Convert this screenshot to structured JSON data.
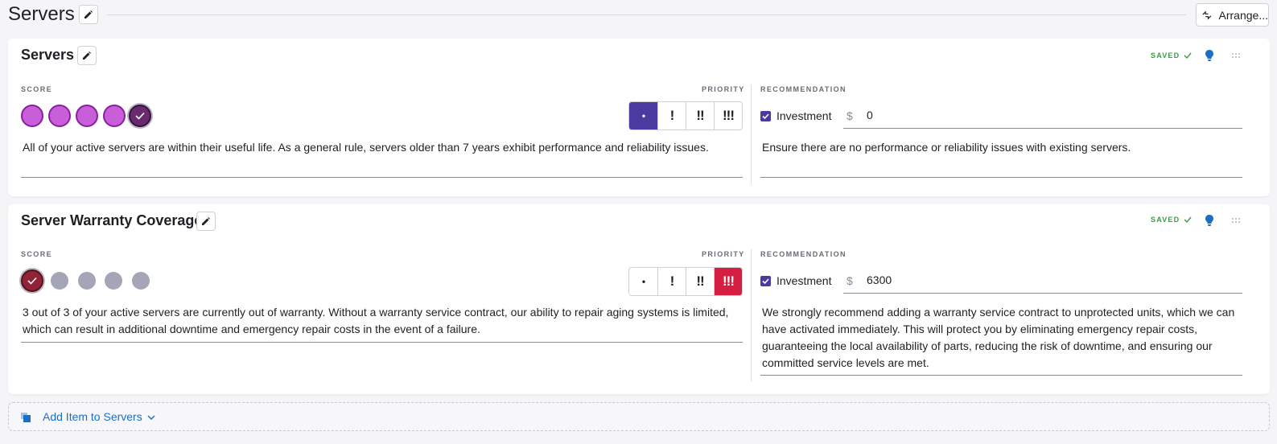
{
  "page": {
    "title": "Servers",
    "arrange_label": "Arrange..."
  },
  "labels": {
    "score": "SCORE",
    "priority": "PRIORITY",
    "recommendation": "RECOMMENDATION",
    "saved": "SAVED",
    "investment": "Investment",
    "currency": "$"
  },
  "priority_options": [
    "•",
    "!",
    "!!",
    "!!!"
  ],
  "cards": [
    {
      "title": "Servers",
      "score": {
        "value": 5,
        "max": 5,
        "color": "#c85fd8"
      },
      "priority_selected": 0,
      "investment_checked": true,
      "investment_value": "0",
      "summary": "All of your active servers are within their useful life. As a general rule, servers older than 7 years exhibit performance and reliability issues.",
      "recommendation": "Ensure there are no performance or reliability issues with existing servers."
    },
    {
      "title": "Server Warranty Coverage",
      "score": {
        "value": 1,
        "max": 5,
        "color": "#8e2436"
      },
      "priority_selected": 3,
      "investment_checked": true,
      "investment_value": "6300",
      "summary": "3 out of 3 of your active servers are currently out of warranty. Without a warranty service contract, our ability to repair aging systems is limited, which can result in additional downtime and emergency repair costs in the event of a failure.",
      "recommendation": "We strongly recommend adding a warranty service contract to unprotected units, which we can have activated immediately. This will protect you by eliminating emergency repair costs, guaranteeing the local availability of parts, reducing the risk of downtime, and ensuring our committed service levels are met."
    }
  ],
  "footer": {
    "add_item_label": "Add Item to Servers"
  },
  "colors": {
    "accent": "#4b3aa0",
    "danger": "#d41f43",
    "link": "#1a6fc4",
    "saved": "#3a9d44"
  }
}
